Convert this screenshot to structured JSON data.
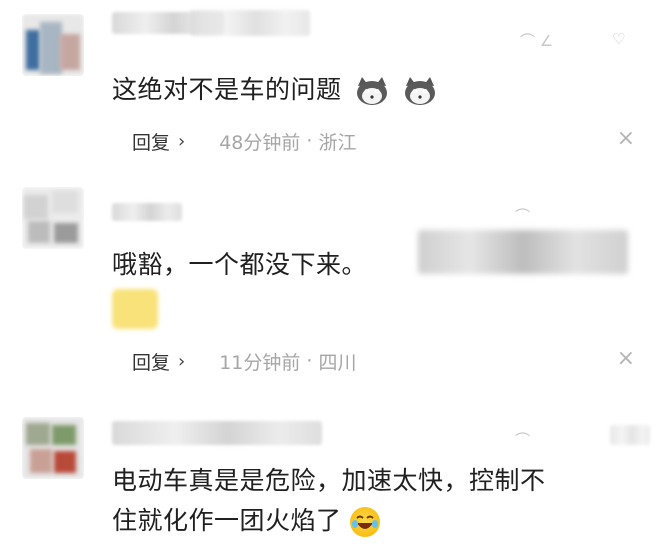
{
  "comments": [
    {
      "text": "这绝对不是车的问题",
      "reply_label": "回复",
      "reply_arrow": "›",
      "time": "48分钟前",
      "separator": "·",
      "location": "浙江",
      "close": "×"
    },
    {
      "text": "哦豁，一个都没下来。",
      "reply_label": "回复",
      "reply_arrow": "›",
      "time": "11分钟前",
      "separator": "·",
      "location": "四川",
      "close": "×"
    },
    {
      "text_line1": "电动车真是是危险，加速太快，控制不",
      "text_line2": "住就化作一团火焰了"
    }
  ],
  "colors": {
    "background": "#ffffff",
    "text": "#202020",
    "meta": "#a6a6a6",
    "close": "#b5b5b5"
  },
  "icons": [
    "cat-emoji-icon",
    "laughing-emoji-icon",
    "close-icon",
    "chevron-right-icon",
    "like-icon"
  ]
}
